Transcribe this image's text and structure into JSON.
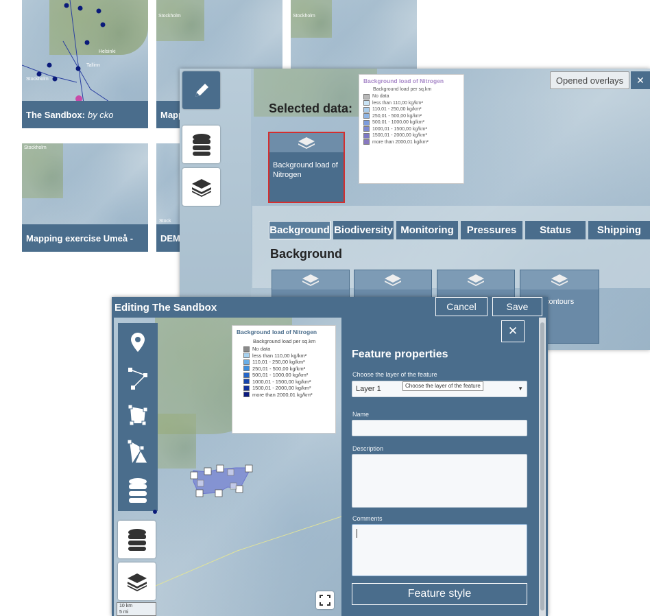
{
  "colors": {
    "panel_blue": "#4a6d8c",
    "panel_dark": "#3e5f7c",
    "accent_red": "#d32f2f",
    "legend_title_purple": "#a98ac9"
  },
  "tiles": [
    {
      "title": "The Sandbox",
      "author": "by cko",
      "map_labels": [
        "Helsinki",
        "Tallinn",
        "Stockholm"
      ]
    },
    {
      "title": "Mapp",
      "map_labels": [
        "Stockholm"
      ]
    },
    {
      "title": "",
      "map_labels": [
        "Stockholm"
      ]
    },
    {
      "title": "Mapping exercise Umeå -",
      "map_labels": [
        "Stockholm"
      ]
    },
    {
      "title": "DEMO",
      "map_labels": [
        "Stock"
      ]
    }
  ],
  "overlay_panel": {
    "opened_overlays_label": "Opened overlays",
    "close_label": "✕",
    "selected_data_heading": "Selected data:",
    "selected_card_label": "Background load of Nitrogen",
    "tabs": [
      "Background",
      "Biodiversity",
      "Monitoring",
      "Pressures",
      "Status",
      "Shipping"
    ],
    "section_heading": "Background",
    "card_fragment_label": "contours",
    "tool_icons": [
      "pencil-icon",
      "database-icon",
      "layers-icon"
    ]
  },
  "legend": {
    "title": "Background load of Nitrogen",
    "subtitle": "Background load per sq.km",
    "entries": [
      {
        "label": "No data",
        "color_small": "#b8b8b8",
        "color_large": "#8a8a8a"
      },
      {
        "label": "less than 110,00 kg/km²",
        "color_small": "#c8e2f3",
        "color_large": "#a8d2f0"
      },
      {
        "label": "110,01 - 250,00 kg/km²",
        "color_small": "#a9cdec",
        "color_large": "#6aaee6"
      },
      {
        "label": "250,01 - 500,00 kg/km²",
        "color_small": "#8fb5e5",
        "color_large": "#3d8ddc"
      },
      {
        "label": "500,01 - 1000,00 kg/km²",
        "color_small": "#7d9ddd",
        "color_large": "#2566c8"
      },
      {
        "label": "1000,01 - 1500,00 kg/km²",
        "color_small": "#7d89d2",
        "color_large": "#1745ac"
      },
      {
        "label": "1500,01 - 2000,00 kg/km²",
        "color_small": "#7d79c5",
        "color_large": "#10309a"
      },
      {
        "label": "more than 2000,01 kg/km²",
        "color_small": "#8878c0",
        "color_large": "#0b1a80"
      }
    ]
  },
  "editor": {
    "title": "Editing The Sandbox",
    "cancel_label": "Cancel",
    "save_label": "Save",
    "close_label": "✕",
    "heading": "Feature properties",
    "layer_label": "Choose the layer of the feature",
    "layer_value": "Layer 1",
    "layer_tooltip": "Choose the layer of the feature",
    "name_label": "Name",
    "name_value": "",
    "description_label": "Description",
    "description_value": "",
    "comments_label": "Comments",
    "comments_value": "",
    "style_button_label": "Feature style",
    "scale_km": "10 km",
    "scale_mi": "5 mi",
    "tools": [
      "marker-icon",
      "line-draw-icon",
      "polygon-icon",
      "triangle-draw-icon",
      "database-icon"
    ],
    "bottom_tools": [
      "database-icon",
      "layers-icon"
    ]
  }
}
